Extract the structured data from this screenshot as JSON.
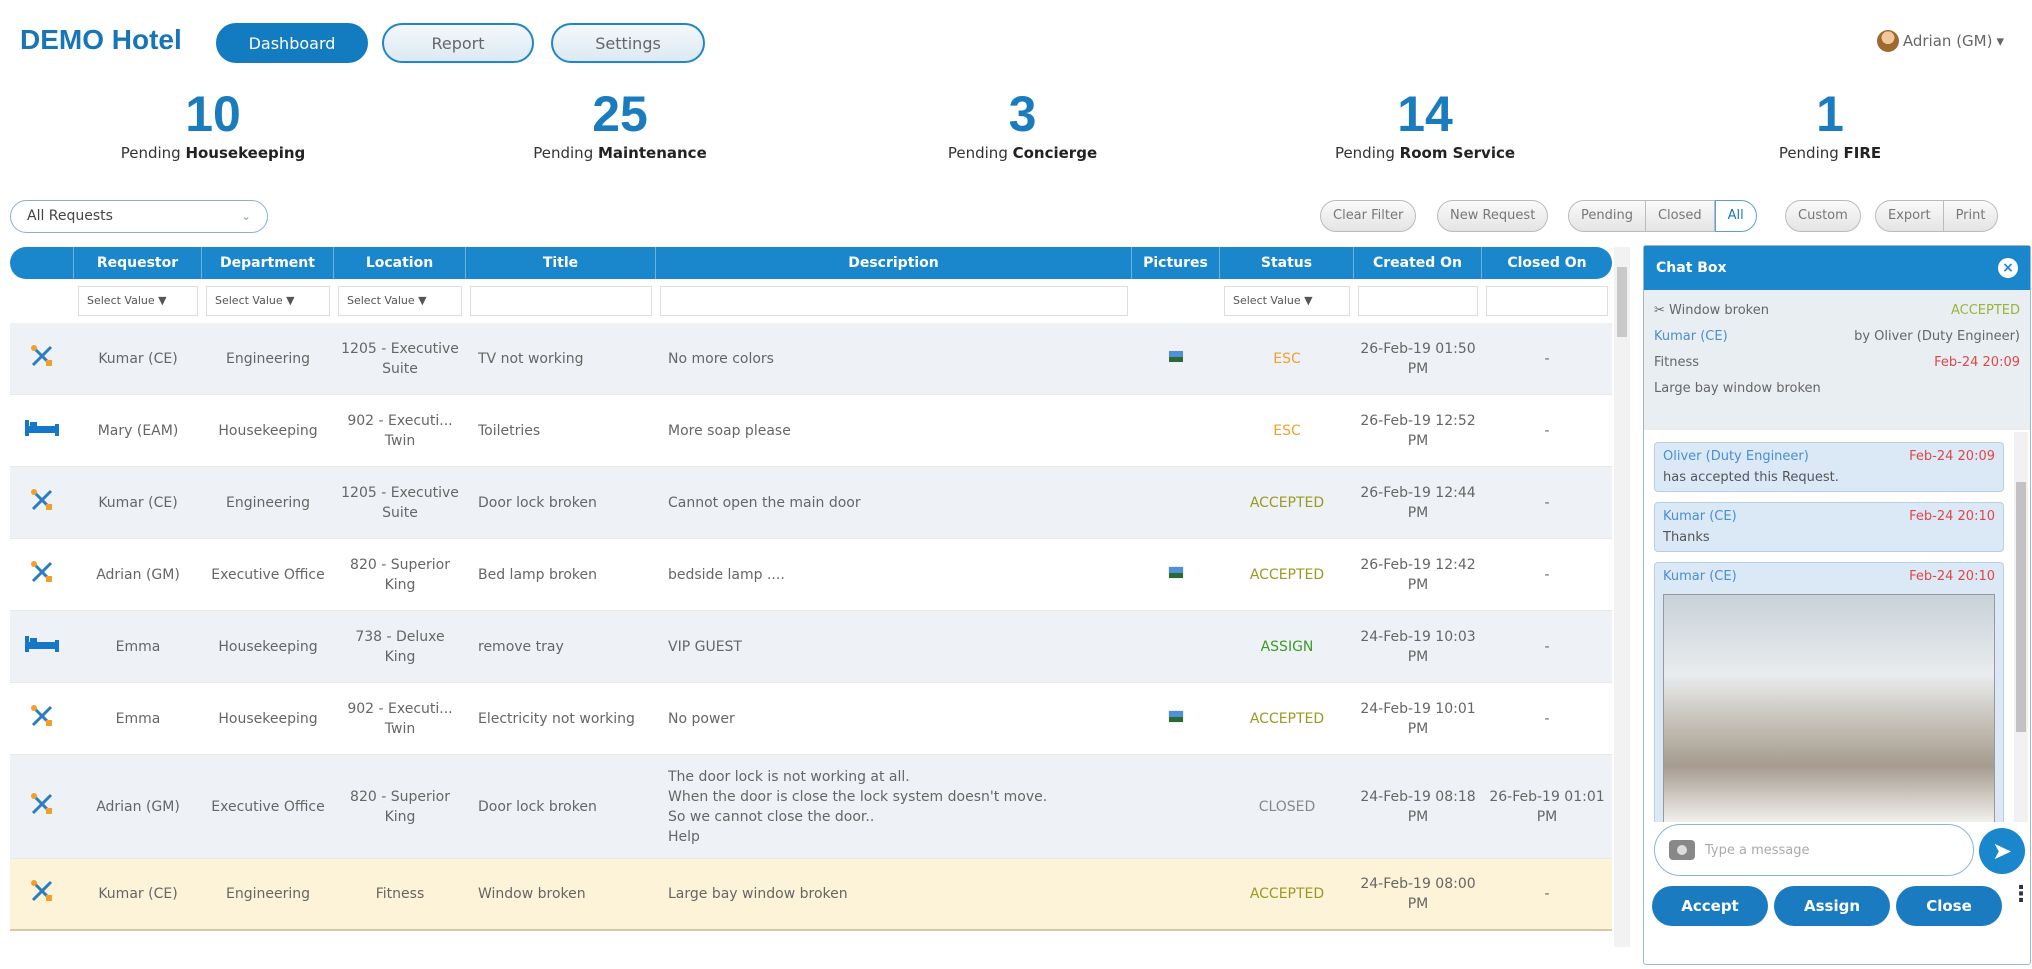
{
  "app": {
    "brand": "DEMO Hotel"
  },
  "nav": {
    "dashboard": "Dashboard",
    "report": "Report",
    "settings": "Settings"
  },
  "user": {
    "name": "Adrian (GM)",
    "caret": "▾"
  },
  "stats": [
    {
      "num": "10",
      "prefix": "Pending ",
      "dept": "Housekeeping"
    },
    {
      "num": "25",
      "prefix": "Pending ",
      "dept": "Maintenance"
    },
    {
      "num": "3",
      "prefix": "Pending ",
      "dept": "Concierge"
    },
    {
      "num": "14",
      "prefix": "Pending ",
      "dept": "Room Service"
    },
    {
      "num": "1",
      "prefix": "Pending ",
      "dept": "FIRE"
    }
  ],
  "filter": {
    "requests_select": "All Requests",
    "chevron": "⌄"
  },
  "toolbar": {
    "clear": "Clear Filter",
    "new": "New Request",
    "pending": "Pending",
    "closed": "Closed",
    "all": "All",
    "custom": "Custom",
    "export": "Export",
    "print": "Print"
  },
  "table": {
    "headers": {
      "requestor": "Requestor",
      "department": "Department",
      "location": "Location",
      "title": "Title",
      "description": "Description",
      "pictures": "Pictures",
      "status": "Status",
      "created": "Created On",
      "closed": "Closed On"
    },
    "select_value": "Select Value ▼",
    "rows": [
      {
        "icon": "tools",
        "requestor": "Kumar (CE)",
        "department": "Engineering",
        "location": "1205 - Executive Suite",
        "title": "TV not working",
        "description": "No more colors",
        "pic": true,
        "status": "ESC",
        "created": "26-Feb-19 01:50 PM",
        "closed": "-"
      },
      {
        "icon": "bed",
        "requestor": "Mary (EAM)",
        "department": "Housekeeping",
        "location": "902 - Executi... Twin",
        "title": "Toiletries",
        "description": "More soap please",
        "pic": false,
        "status": "ESC",
        "created": "26-Feb-19 12:52 PM",
        "closed": "-"
      },
      {
        "icon": "tools",
        "requestor": "Kumar (CE)",
        "department": "Engineering",
        "location": "1205 - Executive Suite",
        "title": "Door lock broken",
        "description": "Cannot open the main door",
        "pic": false,
        "status": "ACCEPTED",
        "created": "26-Feb-19 12:44 PM",
        "closed": "-"
      },
      {
        "icon": "tools",
        "requestor": "Adrian (GM)",
        "department": "Executive Office",
        "location": "820 - Superior King",
        "title": "Bed lamp broken",
        "description": "bedside lamp ....",
        "pic": true,
        "status": "ACCEPTED",
        "created": "26-Feb-19 12:42 PM",
        "closed": "-"
      },
      {
        "icon": "bed",
        "requestor": "Emma",
        "department": "Housekeeping",
        "location": "738 - Deluxe King",
        "title": "remove tray",
        "description": "VIP GUEST",
        "pic": false,
        "status": "ASSIGN",
        "created": "24-Feb-19 10:03 PM",
        "closed": "-"
      },
      {
        "icon": "tools",
        "requestor": "Emma",
        "department": "Housekeeping",
        "location": "902 - Executi... Twin",
        "title": "Electricity not working",
        "description": "No power",
        "pic": true,
        "status": "ACCEPTED",
        "created": "24-Feb-19 10:01 PM",
        "closed": "-"
      },
      {
        "icon": "tools",
        "requestor": "Adrian (GM)",
        "department": "Executive Office",
        "location": "820 - Superior King",
        "title": "Door lock broken",
        "description": "The door lock is not working at all.\nWhen the door is close the lock system doesn't move.\nSo we cannot close the door..\nHelp",
        "pic": false,
        "status": "CLOSED",
        "created": "24-Feb-19 08:18 PM",
        "closed": "26-Feb-19 01:01 PM"
      },
      {
        "icon": "tools",
        "requestor": "Kumar (CE)",
        "department": "Engineering",
        "location": "Fitness",
        "title": "Window broken",
        "description": "Large bay window broken",
        "pic": false,
        "status": "ACCEPTED",
        "created": "24-Feb-19 08:00 PM",
        "closed": "-"
      }
    ]
  },
  "chat": {
    "title": "Chat Box",
    "close": "×",
    "summary": {
      "title": "Window broken",
      "status": "ACCEPTED",
      "requestor": "Kumar (CE)",
      "by": "by Oliver (Duty Engineer)",
      "location": "Fitness",
      "date": "Feb-24 20:09",
      "desc": "Large bay window broken"
    },
    "messages": [
      {
        "author": "Oliver (Duty Engineer)",
        "time": "Feb-24 20:09",
        "text": "has accepted this Request."
      },
      {
        "author": "Kumar (CE)",
        "time": "Feb-24 20:10",
        "text": "Thanks"
      },
      {
        "author": "Kumar (CE)",
        "time": "Feb-24 20:10",
        "text": ""
      }
    ],
    "input_placeholder": "Type a message",
    "send": "➤",
    "actions": {
      "accept": "Accept",
      "assign": "Assign",
      "close": "Close",
      "more": "⋮"
    }
  },
  "colors": {
    "primary": "#1a86cc",
    "esc": "#f0a12c",
    "accepted": "#9a9a22",
    "assign": "#3c9a2a",
    "highlight": "#fcf3d8"
  }
}
